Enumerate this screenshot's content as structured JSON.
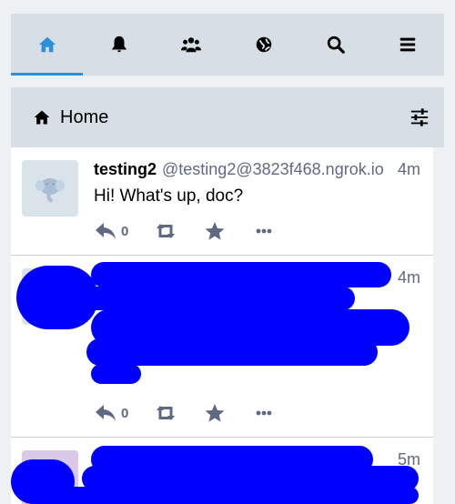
{
  "nav": {
    "tabs": [
      {
        "icon": "home-icon",
        "active": true
      },
      {
        "icon": "bell-icon",
        "active": false
      },
      {
        "icon": "people-icon",
        "active": false
      },
      {
        "icon": "globe-icon",
        "active": false
      },
      {
        "icon": "search-icon",
        "active": false
      },
      {
        "icon": "menu-icon",
        "active": false
      }
    ],
    "accent_color": "#2b90d9"
  },
  "column": {
    "title": "Home"
  },
  "statuses": [
    {
      "display_name": "testing2",
      "handle": "@testing2@3823f468.ngrok.io",
      "time": "4m",
      "content": "Hi! What's up, doc?",
      "reply_count": "0"
    },
    {
      "display_name": "",
      "handle": "",
      "time": "4m",
      "content": "",
      "reply_count": "0",
      "redacted": true
    },
    {
      "display_name": "",
      "handle": "",
      "time": "5m",
      "content": "",
      "redacted": true
    }
  ],
  "colors": {
    "header_bg": "#d7dee6",
    "muted_text": "#606984",
    "icon_color": "#606984"
  }
}
